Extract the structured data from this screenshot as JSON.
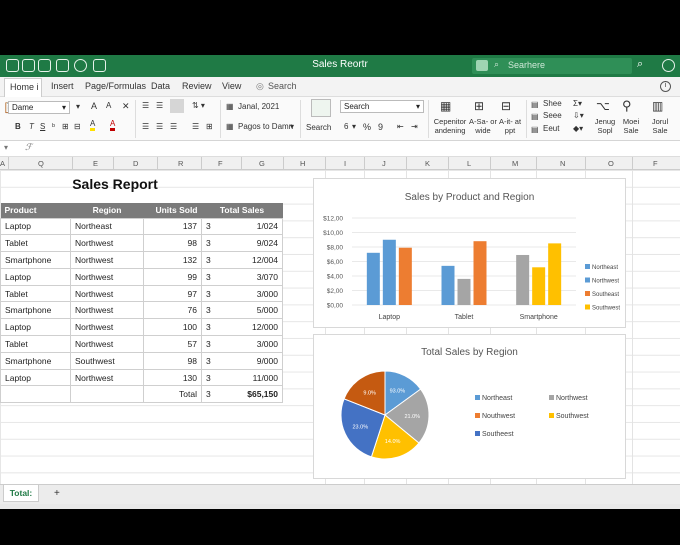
{
  "window": {
    "title": "Sales Reortr",
    "search_placeholder": "Searhere"
  },
  "menu": {
    "tabs": [
      "Home i",
      "Insert",
      "Page/Formulas",
      "Data",
      "Review",
      "View"
    ],
    "tell_me": "Search"
  },
  "ribbon": {
    "font_name": "Dame",
    "date_value": "Janal, 2021",
    "pagos_label": "Pagos to Damn",
    "search_field": "Search",
    "search_button": "Search",
    "zoom_value": "6",
    "percent": "%",
    "nine": "9",
    "group_conditional": "Cepenitor andening",
    "group_asa": "A-Sa- or wide",
    "group_ait": "A-it- at ppt",
    "shee": "Shee",
    "seee": "Seee",
    "eeut": "Eeut",
    "jenug": "Jenug Sopl",
    "moei": "Moei Sale",
    "jorul": "Jorul Sale"
  },
  "formula_bar": {
    "fx": "ℱ"
  },
  "columns": [
    "A",
    "Q",
    "E",
    "D",
    "R",
    "F",
    "G",
    "H",
    "I",
    "J",
    "K",
    "L",
    "M",
    "N",
    "O",
    "F"
  ],
  "sheet": {
    "title": "Sales Report",
    "headers": [
      "Product",
      "Region",
      "Units Sold",
      "Total Sales"
    ],
    "rows": [
      [
        "Laptop",
        "Northeast",
        "137",
        "3",
        "1/024"
      ],
      [
        "Tablet",
        "Northwest",
        "98",
        "3",
        "9/024"
      ],
      [
        "Smartphone",
        "Northwest",
        "132",
        "3",
        "12/004"
      ],
      [
        "Laptop",
        "Northwest",
        "99",
        "3",
        "3/070"
      ],
      [
        "Tablet",
        "Northwest",
        "97",
        "3",
        "3/000"
      ],
      [
        "Smartphone",
        "Northwest",
        "76",
        "3",
        "5/000"
      ],
      [
        "Laptop",
        "Northwest",
        "100",
        "3",
        "12/000"
      ],
      [
        "Tablet",
        "Northwest",
        "57",
        "3",
        "3/000"
      ],
      [
        "Smartphone",
        "Southwest",
        "98",
        "3",
        "9/000"
      ],
      [
        "Laptop",
        "Northwest",
        "130",
        "3",
        "11/000"
      ]
    ],
    "total": {
      "label": "Total",
      "units": "3",
      "sales": "$65,150"
    }
  },
  "bar_chart_title": "Sales by Product and Region",
  "pie_chart_title": "Total Sales by Region",
  "chart_data": [
    {
      "type": "bar",
      "title": "Sales by Product and Region",
      "categories": [
        "Laptop",
        "Tablet",
        "Smartphone"
      ],
      "y_ticks": [
        "$0,00",
        "$2,00",
        "$4,00",
        "$6,00",
        "$8,00",
        "$10,00",
        "$12,00"
      ],
      "ylim": [
        0,
        12
      ],
      "series": [
        {
          "name": "Northeast",
          "color": "#5b9bd5",
          "values": [
            7.2,
            5.4,
            6.9
          ]
        },
        {
          "name": "Northwest",
          "color": "#5b9bd5",
          "values": [
            9.0,
            3.6,
            5.2
          ]
        },
        {
          "name": "Southeast",
          "color": "#ed7d31",
          "values": [
            7.9,
            8.8,
            0
          ]
        },
        {
          "name": "Southwest",
          "color": "#ffc000",
          "values": [
            0,
            0,
            8.5
          ]
        }
      ],
      "bar_colors": [
        [
          "#5b9bd5",
          "#5b9bd5",
          "#ed7d31"
        ],
        [
          "#5b9bd5",
          "#a5a5a5",
          "#ed7d31"
        ],
        [
          "#a5a5a5",
          "#ffc000",
          "#ffc000"
        ]
      ],
      "legend_position": "right"
    },
    {
      "type": "pie",
      "title": "Total Sales by Region",
      "slices": [
        {
          "label": "93.0%",
          "value": 15,
          "color": "#5b9bd5"
        },
        {
          "label": "21.0%",
          "value": 21,
          "color": "#a5a5a5"
        },
        {
          "label": "14.0%",
          "value": 19,
          "color": "#ffc000"
        },
        {
          "label": "23.0%",
          "value": 26,
          "color": "#4472c4"
        },
        {
          "label": "9.0%",
          "value": 19,
          "color": "#c55a11"
        }
      ],
      "legend": [
        {
          "name": "Northeast",
          "color": "#5b9bd5"
        },
        {
          "name": "Northwest",
          "color": "#a5a5a5"
        },
        {
          "name": "Nouthwest",
          "color": "#ed7d31"
        },
        {
          "name": "Southwest",
          "color": "#ffc000"
        },
        {
          "name": "Southeest",
          "color": "#4472c4"
        }
      ]
    }
  ],
  "tabs_bar": {
    "active_sheet": "Total:",
    "add": "+"
  }
}
